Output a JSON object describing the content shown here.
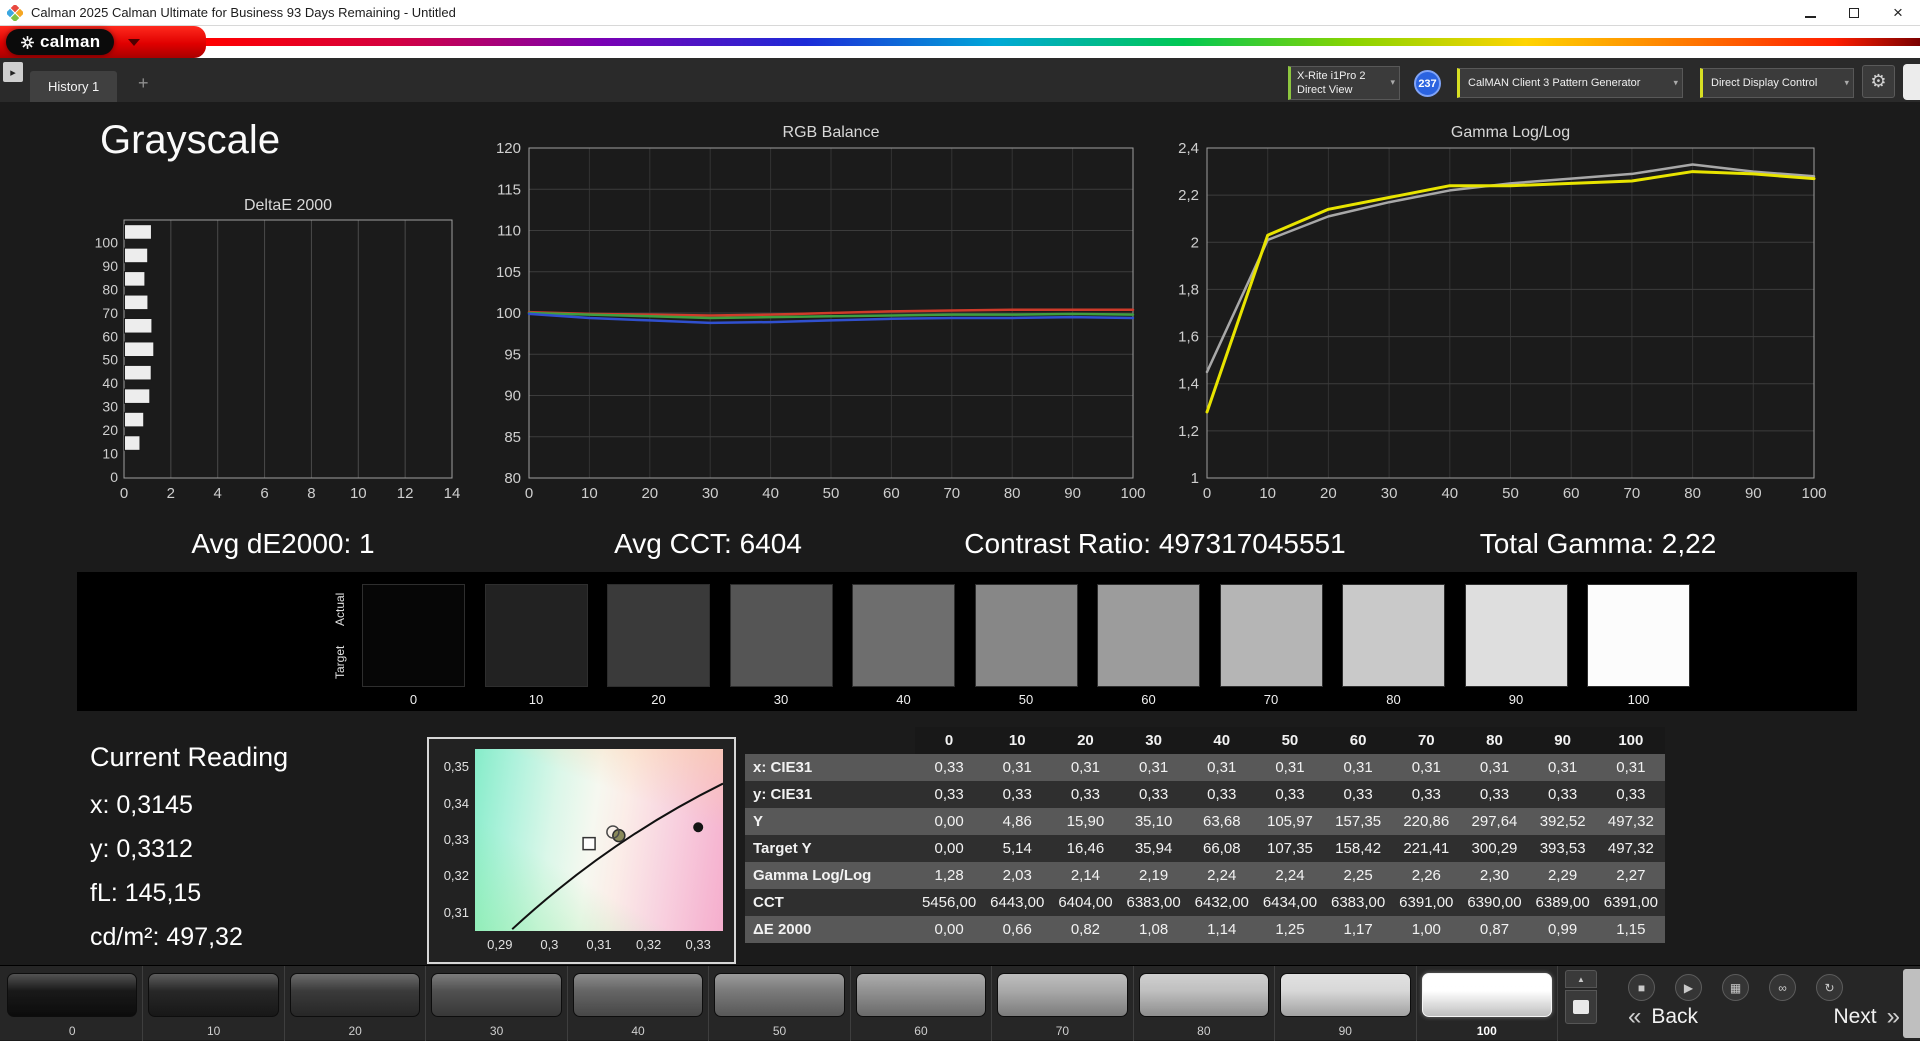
{
  "window": {
    "title": "Calman 2025 Calman Ultimate for Business 93 Days Remaining  - Untitled",
    "controls": {
      "close": "×"
    }
  },
  "brand": {
    "name": "calman"
  },
  "icons": {
    "dropdown": "▾",
    "chevron_up": "▲"
  },
  "tab_bar": {
    "collapse_arrow": "▸",
    "tabs": [
      {
        "label": "History 1",
        "selected": true
      }
    ],
    "add_tab": "+",
    "meter": {
      "line1": "X-Rite i1Pro 2",
      "line2": "Direct View",
      "accent": "#8dc63f",
      "badge": "237"
    },
    "pattern_generator": {
      "label": "CalMAN Client 3 Pattern Generator",
      "accent": "#d7df23"
    },
    "display_control": {
      "label": "Direct Display Control",
      "accent": "#d7df23"
    },
    "settings_icon": "⚙"
  },
  "page": {
    "title": "Grayscale"
  },
  "stats": [
    {
      "id": "avg-de2000",
      "text": "Avg dE2000: 1"
    },
    {
      "id": "avg-cct",
      "text": "Avg CCT: 6404"
    },
    {
      "id": "contrast-ratio",
      "text": "Contrast Ratio: 497317045551"
    },
    {
      "id": "total-gamma",
      "text": "Total Gamma: 2,22"
    }
  ],
  "chart_data": [
    {
      "id": "deltae-2000",
      "type": "bar",
      "orientation": "horizontal",
      "title": "DeltaE 2000",
      "categories": [
        100,
        90,
        80,
        70,
        60,
        50,
        40,
        30,
        20,
        10,
        0
      ],
      "values": [
        1.15,
        0.99,
        0.87,
        1.0,
        1.17,
        1.25,
        1.14,
        1.08,
        0.82,
        0.66,
        0.0
      ],
      "xlim": [
        0,
        14
      ],
      "x_ticks": [
        0,
        2,
        4,
        6,
        8,
        10,
        12,
        14
      ],
      "bar_color": "#ededed",
      "grid": true
    },
    {
      "id": "rgb-balance",
      "type": "line",
      "title": "RGB Balance",
      "x": [
        0,
        10,
        20,
        30,
        40,
        50,
        60,
        70,
        80,
        90,
        100
      ],
      "ylim": [
        80,
        120
      ],
      "y_ticks": [
        80,
        85,
        90,
        95,
        100,
        105,
        110,
        115,
        120
      ],
      "series": [
        {
          "name": "Red",
          "color": "#cf3b2a",
          "values": [
            100.1,
            99.9,
            99.8,
            99.7,
            99.8,
            100.0,
            100.2,
            100.3,
            100.4,
            100.4,
            100.4
          ]
        },
        {
          "name": "Green",
          "color": "#3f9e3f",
          "values": [
            100.0,
            99.8,
            99.6,
            99.4,
            99.5,
            99.6,
            99.7,
            99.8,
            99.8,
            99.9,
            99.8
          ]
        },
        {
          "name": "Blue",
          "color": "#3050cf",
          "values": [
            99.9,
            99.4,
            99.1,
            98.8,
            98.9,
            99.1,
            99.3,
            99.4,
            99.4,
            99.5,
            99.4
          ]
        }
      ],
      "grid": true
    },
    {
      "id": "gamma-log-log",
      "type": "line",
      "title": "Gamma Log/Log",
      "x": [
        0,
        10,
        20,
        30,
        40,
        50,
        60,
        70,
        80,
        90,
        100
      ],
      "ylim": [
        1,
        2.4
      ],
      "y_ticks": [
        {
          "v": 1,
          "label": "1"
        },
        {
          "v": 1.2,
          "label": "1,2"
        },
        {
          "v": 1.4,
          "label": "1,4"
        },
        {
          "v": 1.6,
          "label": "1,6"
        },
        {
          "v": 1.8,
          "label": "1,8"
        },
        {
          "v": 2,
          "label": "2"
        },
        {
          "v": 2.2,
          "label": "2,2"
        },
        {
          "v": 2.4,
          "label": "2,4"
        }
      ],
      "series": [
        {
          "name": "Reference",
          "color": "#a8a8a8",
          "values": [
            1.45,
            2.01,
            2.11,
            2.17,
            2.22,
            2.25,
            2.27,
            2.29,
            2.33,
            2.3,
            2.28
          ]
        },
        {
          "name": "Gamma",
          "color": "#e8e400",
          "width": 3,
          "values": [
            1.28,
            2.03,
            2.14,
            2.19,
            2.24,
            2.24,
            2.25,
            2.26,
            2.3,
            2.29,
            2.27
          ]
        }
      ],
      "grid": true
    },
    {
      "id": "cie-1931",
      "type": "scatter",
      "title": "CIE chromaticity detail",
      "xlim": [
        0.285,
        0.335
      ],
      "ylim": [
        0.305,
        0.355
      ],
      "x_ticks": [
        {
          "v": 0.29,
          "label": "0,29"
        },
        {
          "v": 0.3,
          "label": "0,3"
        },
        {
          "v": 0.31,
          "label": "0,31"
        },
        {
          "v": 0.32,
          "label": "0,32"
        },
        {
          "v": 0.33,
          "label": "0,33"
        }
      ],
      "y_ticks": [
        {
          "v": 0.31,
          "label": "0,31"
        },
        {
          "v": 0.32,
          "label": "0,32"
        },
        {
          "v": 0.33,
          "label": "0,33"
        },
        {
          "v": 0.34,
          "label": "0,34"
        },
        {
          "v": 0.35,
          "label": "0,35"
        }
      ],
      "locus": [
        [
          0.2925,
          0.3055
        ],
        [
          0.312,
          0.33
        ],
        [
          0.335,
          0.3455
        ]
      ],
      "points": [
        {
          "x": 0.33,
          "y": 0.3335,
          "marker": "target-dot",
          "color": "#141414"
        },
        {
          "x": 0.308,
          "y": 0.329,
          "marker": "target-square",
          "color": "#ffffff"
        },
        {
          "x": 0.314,
          "y": 0.3312,
          "marker": "reading-circle",
          "color": "#8a8a5a"
        },
        {
          "x": 0.3128,
          "y": 0.3322,
          "marker": "reading-ring",
          "color": "#4a4a4a"
        }
      ]
    }
  ],
  "swatches": {
    "row_labels": [
      "Actual",
      "Target"
    ],
    "levels": [
      {
        "label": "0",
        "color": "#060606"
      },
      {
        "label": "10",
        "color": "#222222"
      },
      {
        "label": "20",
        "color": "#3a3a3a"
      },
      {
        "label": "30",
        "color": "#555555"
      },
      {
        "label": "40",
        "color": "#6e6e6e"
      },
      {
        "label": "50",
        "color": "#878787"
      },
      {
        "label": "60",
        "color": "#9c9c9c"
      },
      {
        "label": "70",
        "color": "#b5b5b5"
      },
      {
        "label": "80",
        "color": "#c9c9c9"
      },
      {
        "label": "90",
        "color": "#dedede"
      },
      {
        "label": "100",
        "color": "#fcfcfc"
      }
    ]
  },
  "current_reading": {
    "title": "Current Reading",
    "lines": [
      "x: 0,3145",
      "y: 0,3312",
      "fL: 145,15",
      "cd/m²: 497,32"
    ]
  },
  "table": {
    "columns": [
      "",
      "0",
      "10",
      "20",
      "30",
      "40",
      "50",
      "60",
      "70",
      "80",
      "90",
      "100"
    ],
    "rows": [
      {
        "label": "x: CIE31",
        "values": [
          "0,33",
          "0,31",
          "0,31",
          "0,31",
          "0,31",
          "0,31",
          "0,31",
          "0,31",
          "0,31",
          "0,31",
          "0,31"
        ]
      },
      {
        "label": "y: CIE31",
        "values": [
          "0,33",
          "0,33",
          "0,33",
          "0,33",
          "0,33",
          "0,33",
          "0,33",
          "0,33",
          "0,33",
          "0,33",
          "0,33"
        ]
      },
      {
        "label": "Y",
        "values": [
          "0,00",
          "4,86",
          "15,90",
          "35,10",
          "63,68",
          "105,97",
          "157,35",
          "220,86",
          "297,64",
          "392,52",
          "497,32"
        ]
      },
      {
        "label": "Target Y",
        "values": [
          "0,00",
          "5,14",
          "16,46",
          "35,94",
          "66,08",
          "107,35",
          "158,42",
          "221,41",
          "300,29",
          "393,53",
          "497,32"
        ]
      },
      {
        "label": "Gamma Log/Log",
        "values": [
          "1,28",
          "2,03",
          "2,14",
          "2,19",
          "2,24",
          "2,24",
          "2,25",
          "2,26",
          "2,30",
          "2,29",
          "2,27"
        ]
      },
      {
        "label": "CCT",
        "values": [
          "5456,00",
          "6443,00",
          "6404,00",
          "6383,00",
          "6432,00",
          "6434,00",
          "6383,00",
          "6391,00",
          "6390,00",
          "6389,00",
          "6391,00"
        ]
      },
      {
        "label": "ΔE 2000",
        "values": [
          "0,00",
          "0,66",
          "0,82",
          "1,08",
          "1,14",
          "1,25",
          "1,17",
          "1,00",
          "0,87",
          "0,99",
          "1,15"
        ]
      }
    ]
  },
  "bottom_bar": {
    "pattern_buttons": [
      {
        "label": "0",
        "color": "#101010"
      },
      {
        "label": "10",
        "color": "#1f1f1f"
      },
      {
        "label": "20",
        "color": "#333333"
      },
      {
        "label": "30",
        "color": "#4a4a4a"
      },
      {
        "label": "40",
        "color": "#5f5f5f"
      },
      {
        "label": "50",
        "color": "#757575"
      },
      {
        "label": "60",
        "color": "#8d8d8d"
      },
      {
        "label": "70",
        "color": "#a5a5a5"
      },
      {
        "label": "80",
        "color": "#bdbdbd"
      },
      {
        "label": "90",
        "color": "#d6d6d6"
      },
      {
        "label": "100",
        "color": "#ffffff",
        "selected": true
      }
    ],
    "transport": [
      {
        "name": "stop",
        "glyph": "■"
      },
      {
        "name": "play",
        "glyph": "▶"
      },
      {
        "name": "save",
        "glyph": "▦"
      },
      {
        "name": "continuous",
        "glyph": "∞"
      },
      {
        "name": "repeat",
        "glyph": "↻"
      }
    ],
    "back_chevron": "«",
    "back_label": "Back",
    "next_label": "Next",
    "next_chevron": "»"
  }
}
